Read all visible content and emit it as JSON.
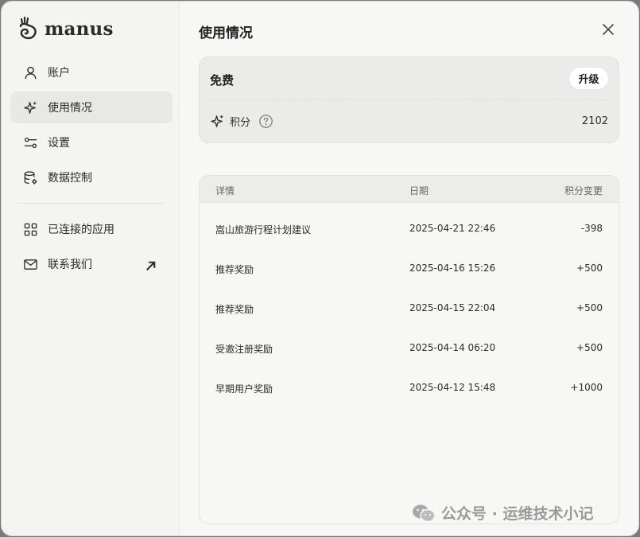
{
  "app": {
    "logo_text": "manus"
  },
  "sidebar": {
    "items": [
      {
        "label": "账户",
        "icon": "user-icon"
      },
      {
        "label": "使用情况",
        "icon": "sparkle-icon",
        "active": true
      },
      {
        "label": "设置",
        "icon": "sliders-icon"
      },
      {
        "label": "数据控制",
        "icon": "database-gear-icon"
      },
      {
        "label": "已连接的应用",
        "icon": "grid-icon"
      },
      {
        "label": "联系我们",
        "icon": "mail-icon"
      }
    ]
  },
  "main": {
    "title": "使用情况",
    "plan": {
      "label": "免费",
      "upgrade_label": "升级"
    },
    "credits": {
      "label": "积分",
      "value": "2102"
    },
    "table": {
      "headers": {
        "detail": "详情",
        "date": "日期",
        "change": "积分变更"
      },
      "rows": [
        {
          "detail": "嵩山旅游行程计划建议",
          "date": "2025-04-21 22:46",
          "change": "-398"
        },
        {
          "detail": "推荐奖励",
          "date": "2025-04-16 15:26",
          "change": "+500"
        },
        {
          "detail": "推荐奖励",
          "date": "2025-04-15 22:04",
          "change": "+500"
        },
        {
          "detail": "受邀注册奖励",
          "date": "2025-04-14 06:20",
          "change": "+500"
        },
        {
          "detail": "早期用户奖励",
          "date": "2025-04-12 15:48",
          "change": "+1000"
        }
      ]
    }
  },
  "watermark": {
    "text": "公众号 · 运维技术小记"
  },
  "colors": {
    "accent_bg": "#e8e8e5",
    "card_bg": "#ebebe9",
    "page_bg": "#f7f7f5"
  }
}
